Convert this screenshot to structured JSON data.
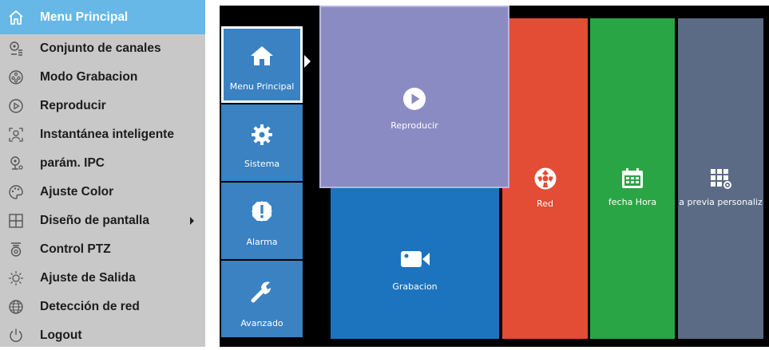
{
  "menu": {
    "items": [
      {
        "label": "Menu Principal",
        "icon": "home-icon",
        "active": true
      },
      {
        "label": "Conjunto de canales",
        "icon": "channel-settings-icon"
      },
      {
        "label": "Modo Grabacion",
        "icon": "film-reel-icon"
      },
      {
        "label": "Reproducir",
        "icon": "play-circle-icon"
      },
      {
        "label": "Instantánea inteligente",
        "icon": "face-snapshot-icon"
      },
      {
        "label": "parám. IPC",
        "icon": "ipc-camera-icon"
      },
      {
        "label": "Ajuste Color",
        "icon": "palette-icon"
      },
      {
        "label": "Diseño de pantalla",
        "icon": "grid-layout-icon",
        "submenu": true
      },
      {
        "label": "Control PTZ",
        "icon": "ptz-camera-icon"
      },
      {
        "label": "Ajuste de Salida",
        "icon": "brightness-icon"
      },
      {
        "label": "Detección de red",
        "icon": "globe-icon"
      },
      {
        "label": "Logout",
        "icon": "power-icon"
      }
    ]
  },
  "launcher": {
    "side_tiles": [
      {
        "label": "Menu Principal",
        "icon": "home-icon",
        "selected": true
      },
      {
        "label": "Sistema",
        "icon": "gear-icon"
      },
      {
        "label": "Alarma",
        "icon": "alarm-icon"
      },
      {
        "label": "Avanzado",
        "icon": "wrench-icon"
      }
    ],
    "tiles": {
      "reproducir": {
        "label": "Reproducir",
        "icon": "play-icon"
      },
      "grabacion": {
        "label": "Grabacion",
        "icon": "video-camera-icon"
      },
      "red": {
        "label": "Red",
        "icon": "network-icon"
      },
      "fecha_hora": {
        "label": "fecha Hora",
        "icon": "calendar-icon"
      },
      "vista_previa": {
        "label": "a previa personaliz",
        "icon": "grid-settings-icon"
      }
    }
  },
  "colors": {
    "menu_bg": "#c8c8c8",
    "menu_active": "#67b8e6",
    "side_tile": "#3a82c2",
    "reproducir": "#8b8bc4",
    "grabacion": "#1d74be",
    "red": "#e34c35",
    "fecha_hora": "#2aa545",
    "vista_previa": "#5b6b85"
  }
}
